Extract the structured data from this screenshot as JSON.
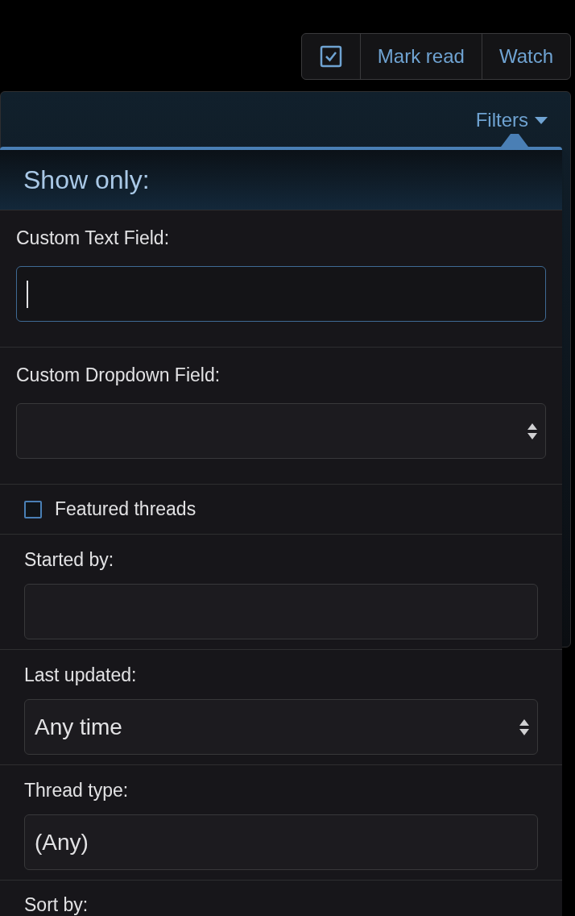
{
  "toolbar": {
    "buttons": [
      {
        "kind": "icon"
      },
      {
        "kind": "text",
        "label": "Mark read"
      },
      {
        "kind": "text",
        "label": "Watch"
      }
    ]
  },
  "filters_button": {
    "label": "Filters",
    "expanded": true
  },
  "menu": {
    "title": "Show only:",
    "fields": [
      {
        "kind": "text",
        "label": "Custom Text Field:",
        "focused": true
      },
      {
        "kind": "select",
        "label": "Custom Dropdown Field:"
      },
      {
        "kind": "checkbox",
        "label": "Featured threads",
        "checked": false
      },
      {
        "kind": "text",
        "label": "Started by:",
        "focused": false
      },
      {
        "kind": "select",
        "label": "Last updated:",
        "value": "Any time"
      },
      {
        "kind": "text",
        "label": "Thread type:",
        "value": "(Any)",
        "focused": false
      },
      {
        "kind": "heading",
        "label": "Sort by:"
      }
    ]
  }
}
